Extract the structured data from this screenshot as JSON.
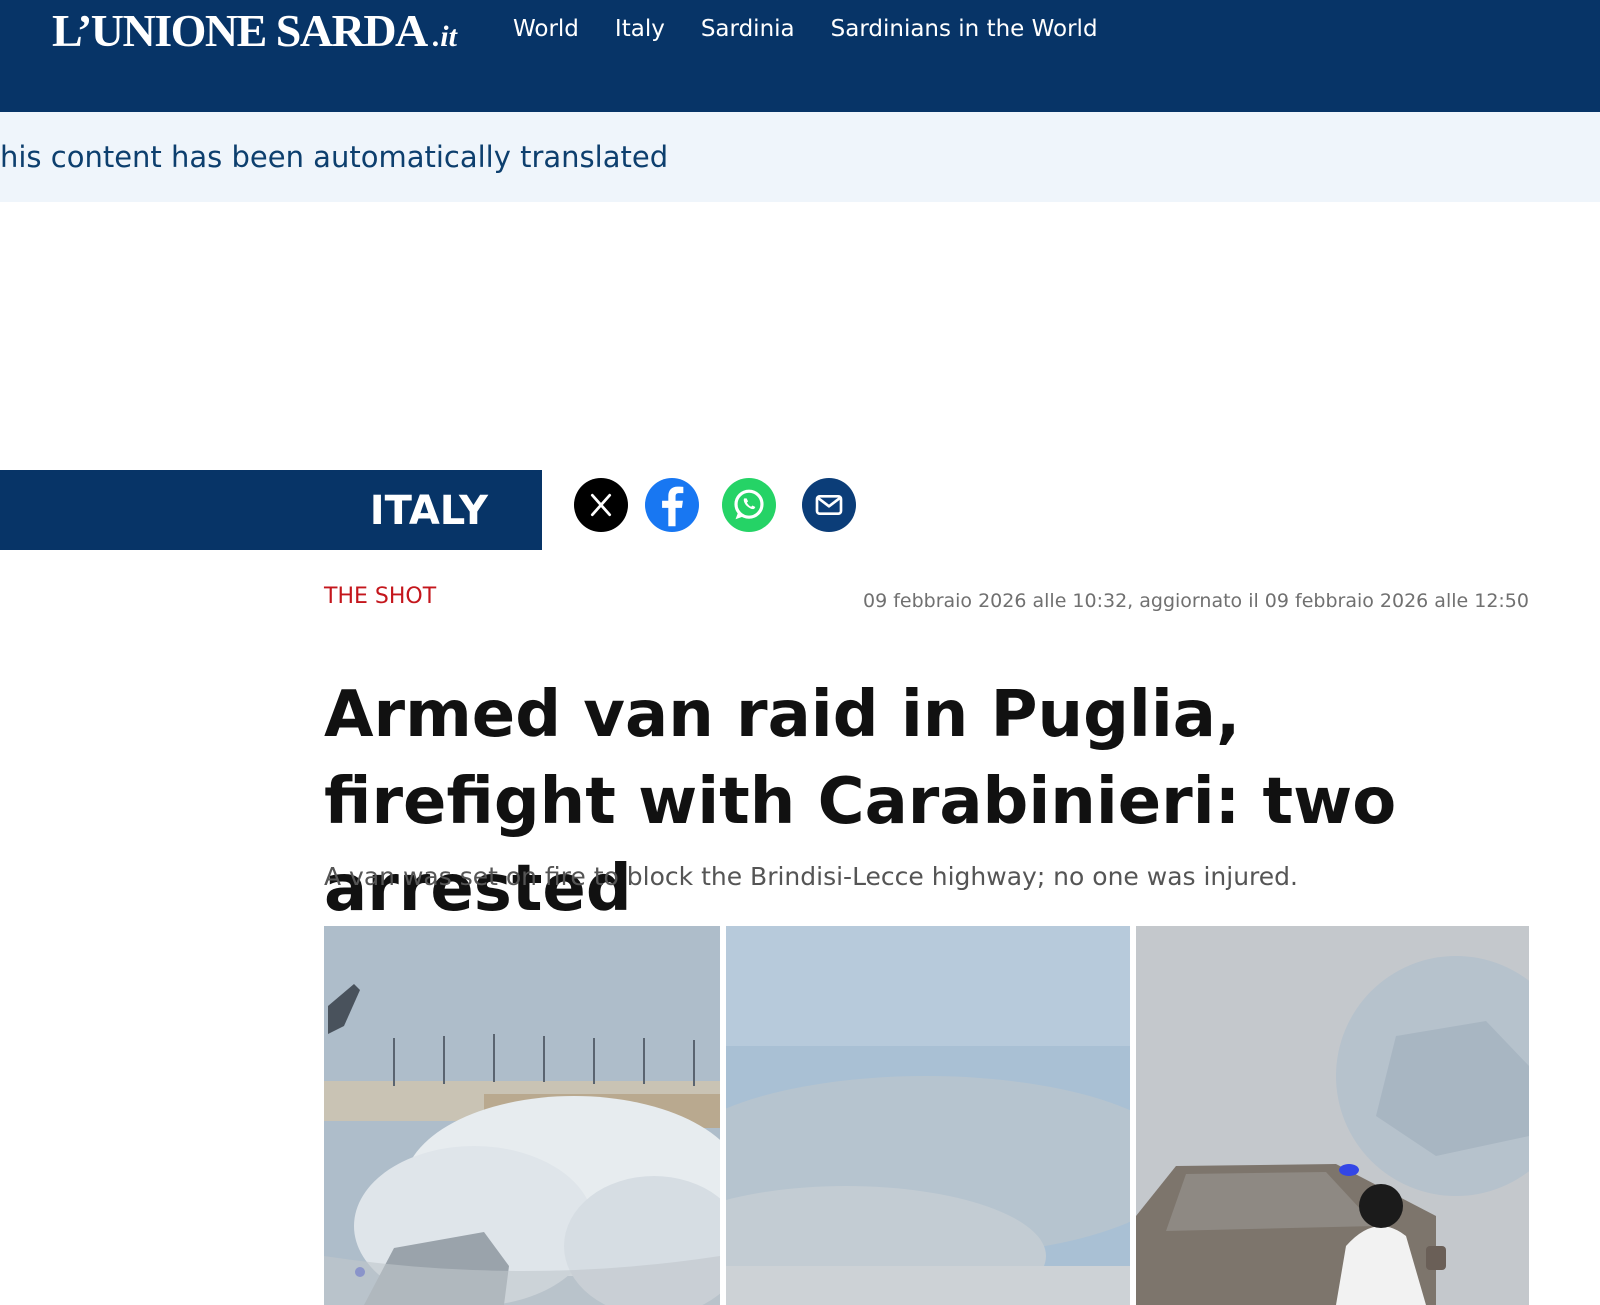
{
  "header": {
    "logo_main": "L’UNIONE SARDA",
    "logo_suffix": ".it",
    "nav": [
      {
        "label": "World"
      },
      {
        "label": "Italy"
      },
      {
        "label": "Sardinia"
      },
      {
        "label": "Sardinians in the World"
      }
    ]
  },
  "notice": {
    "text": "his content has been automatically translated"
  },
  "section": {
    "label": "ITALY"
  },
  "share": [
    {
      "network": "X",
      "icon": "x-icon",
      "color": "#000000"
    },
    {
      "network": "Facebook",
      "icon": "facebook-icon",
      "color": "#1877f2"
    },
    {
      "network": "WhatsApp",
      "icon": "whatsapp-icon",
      "color": "#25d366"
    },
    {
      "network": "Email",
      "icon": "mail-icon",
      "color": "#0b3d78"
    }
  ],
  "article": {
    "kicker": "THE SHOT",
    "timestamp": "09 febbraio 2026 alle 10:32, aggiornato il 09 febbraio 2026 alle 12:50",
    "headline": "Armed van raid in Puglia, firefight with Carabinieri: two arrested",
    "subheadline": "A van was set on fire to block the Brindisi-Lecce highway; no one was injured."
  },
  "colors": {
    "brand": "#073467",
    "kicker": "#c4161c",
    "notice_bg": "#eff5fb"
  }
}
